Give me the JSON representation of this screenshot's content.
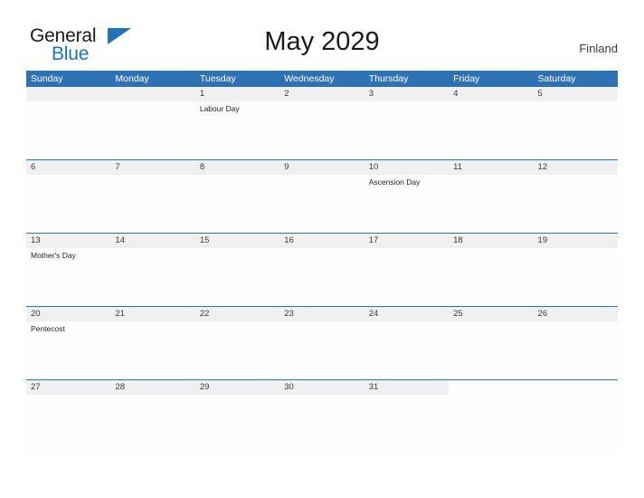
{
  "brand": {
    "name_part1": "General",
    "name_part2": "Blue",
    "flag_icon": "triangle-flag-icon",
    "primary_color": "#2272bb"
  },
  "header": {
    "title": "May 2029",
    "region": "Finland"
  },
  "theme": {
    "header_blue": "#2f72b4",
    "daynum_band_gray": "#f0f0f0",
    "row_divider": "#2f72b4",
    "page_background": "#ffffff"
  },
  "calendar": {
    "month": "May",
    "year": "2029",
    "country": "Finland",
    "weekdays": [
      "Sunday",
      "Monday",
      "Tuesday",
      "Wednesday",
      "Thursday",
      "Friday",
      "Saturday"
    ],
    "weeks": [
      [
        {
          "day": "",
          "events": []
        },
        {
          "day": "",
          "events": []
        },
        {
          "day": "1",
          "events": [
            "Labour Day"
          ]
        },
        {
          "day": "2",
          "events": []
        },
        {
          "day": "3",
          "events": []
        },
        {
          "day": "4",
          "events": []
        },
        {
          "day": "5",
          "events": []
        }
      ],
      [
        {
          "day": "6",
          "events": []
        },
        {
          "day": "7",
          "events": []
        },
        {
          "day": "8",
          "events": []
        },
        {
          "day": "9",
          "events": []
        },
        {
          "day": "10",
          "events": [
            "Ascension Day"
          ]
        },
        {
          "day": "11",
          "events": []
        },
        {
          "day": "12",
          "events": []
        }
      ],
      [
        {
          "day": "13",
          "events": [
            "Mother's Day"
          ]
        },
        {
          "day": "14",
          "events": []
        },
        {
          "day": "15",
          "events": []
        },
        {
          "day": "16",
          "events": []
        },
        {
          "day": "17",
          "events": []
        },
        {
          "day": "18",
          "events": []
        },
        {
          "day": "19",
          "events": []
        }
      ],
      [
        {
          "day": "20",
          "events": [
            "Pentecost"
          ]
        },
        {
          "day": "21",
          "events": []
        },
        {
          "day": "22",
          "events": []
        },
        {
          "day": "23",
          "events": []
        },
        {
          "day": "24",
          "events": []
        },
        {
          "day": "25",
          "events": []
        },
        {
          "day": "26",
          "events": []
        }
      ],
      [
        {
          "day": "27",
          "events": []
        },
        {
          "day": "28",
          "events": []
        },
        {
          "day": "29",
          "events": []
        },
        {
          "day": "30",
          "events": []
        },
        {
          "day": "31",
          "events": []
        },
        {
          "day": "",
          "events": []
        },
        {
          "day": "",
          "events": []
        }
      ]
    ]
  }
}
